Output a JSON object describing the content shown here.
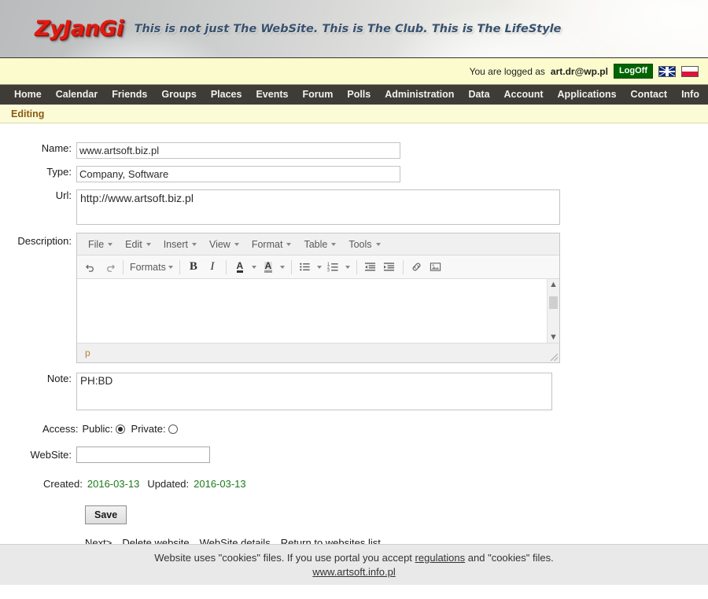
{
  "header": {
    "logo": "ZyJanGi",
    "tagline": "This is not just The WebSite. This is The Club. This is The LifeStyle"
  },
  "loginbar": {
    "logged_as_prefix": "You are logged as",
    "user": "art.dr@wp.pl",
    "logoff_label": "LogOff",
    "flags": [
      "uk-flag-icon",
      "poland-flag-icon"
    ]
  },
  "nav": {
    "items": [
      "Home",
      "Calendar",
      "Friends",
      "Groups",
      "Places",
      "Events",
      "Forum",
      "Polls",
      "Administration",
      "Data",
      "Account",
      "Applications",
      "Contact",
      "Info"
    ]
  },
  "section": {
    "title": "Editing"
  },
  "form": {
    "name_label": "Name:",
    "name_value": "www.artsoft.biz.pl",
    "type_label": "Type:",
    "type_value": "Company, Software",
    "url_label": "Url:",
    "url_value": "http://www.artsoft.biz.pl",
    "description_label": "Description:",
    "note_label": "Note:",
    "note_value": "PH:BD",
    "access_label": "Access:",
    "public_label": "Public:",
    "private_label": "Private:",
    "access_selected": "Public",
    "website_label": "WebSite:",
    "website_value": "",
    "created_label": "Created:",
    "created_value": "2016-03-13",
    "updated_label": "Updated:",
    "updated_value": "2016-03-13",
    "save_label": "Save"
  },
  "editor": {
    "menu": [
      "File",
      "Edit",
      "Insert",
      "View",
      "Format",
      "Table",
      "Tools"
    ],
    "toolbar": {
      "undo": "undo-icon",
      "redo": "redo-icon",
      "formats": "Formats",
      "bold": "B",
      "italic": "I",
      "text_color": "A",
      "background_color": "A",
      "bullet_list": "bullet-list-icon",
      "numbered_list": "numbered-list-icon",
      "outdent": "outdent-icon",
      "indent": "indent-icon",
      "link": "link-icon",
      "image": "image-icon"
    },
    "content": "",
    "statusbar_path": "p"
  },
  "links": {
    "next": "Next>",
    "delete": "Delete website",
    "details": "WebSite details",
    "return": "Return to websites list"
  },
  "footer": {
    "text_before": "Website uses \"cookies\" files. If you use portal you accept",
    "regulations_link": "regulations",
    "text_after": "and \"cookies\" files.",
    "site_link": "www.artsoft.info.pl"
  },
  "colors": {
    "nav_bg": "#3f3c38",
    "section_bg": "#fcfbd8",
    "section_text": "#8a5a12",
    "logoff_bg": "#006400",
    "logo_red": "#e01b12",
    "tagline_blue": "#39526e",
    "date_green": "#1a7a1a"
  }
}
